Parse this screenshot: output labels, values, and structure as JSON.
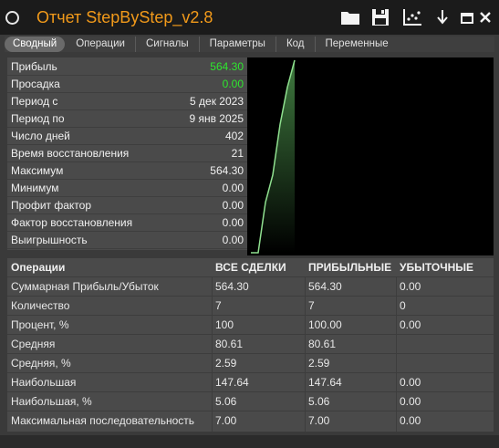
{
  "window": {
    "title": "Отчет StepByStep_v2.8"
  },
  "toolbar": {
    "icons": [
      "folder-icon",
      "save-icon",
      "chart-export-icon",
      "download-icon",
      "minimize-icon",
      "close-icon"
    ]
  },
  "tabs": [
    {
      "label": "Сводный",
      "active": true
    },
    {
      "label": "Операции",
      "active": false
    },
    {
      "label": "Сигналы",
      "active": false
    },
    {
      "label": "Параметры",
      "active": false
    },
    {
      "label": "Код",
      "active": false
    },
    {
      "label": "Переменные",
      "active": false
    }
  ],
  "summary": {
    "rows": [
      {
        "label": "Прибыль",
        "value": "564.30",
        "color": "#2ee62e"
      },
      {
        "label": "Просадка",
        "value": "0.00",
        "color": "#2ee62e"
      },
      {
        "label": "Период с",
        "value": "5 дек 2023"
      },
      {
        "label": "Период по",
        "value": "9 янв 2025"
      },
      {
        "label": "Число дней",
        "value": "402"
      },
      {
        "label": "Время восстановления",
        "value": "21"
      },
      {
        "label": "Максимум",
        "value": "564.30"
      },
      {
        "label": "Минимум",
        "value": "0.00"
      },
      {
        "label": "Профит фактор",
        "value": "0.00"
      },
      {
        "label": "Фактор восстановления",
        "value": "0.00"
      },
      {
        "label": "Выигрышность",
        "value": "0.00"
      }
    ]
  },
  "chart_data": {
    "type": "area",
    "x": [
      0,
      1,
      2,
      3,
      4,
      5,
      6
    ],
    "values": [
      0,
      0,
      147.64,
      228.25,
      375.89,
      485.0,
      564.3
    ],
    "ylim": [
      0,
      564.3
    ],
    "line_color": "#8fe08f",
    "fill_top": "#3f7a3f",
    "fill_bottom": "#000000",
    "title": "",
    "xlabel": "",
    "ylabel": ""
  },
  "table": {
    "headers": [
      "Операции",
      "ВСЕ СДЕЛКИ",
      "ПРИБЫЛЬНЫЕ",
      "УБЫТОЧНЫЕ"
    ],
    "rows": [
      [
        "Суммарная Прибыль/Убыток",
        "564.30",
        "564.30",
        "0.00"
      ],
      [
        "Количество",
        "7",
        "7",
        "0"
      ],
      [
        "Процент, %",
        "100",
        "100.00",
        "0.00"
      ],
      [
        "Средняя",
        "80.61",
        "80.61",
        ""
      ],
      [
        "Средняя, %",
        "2.59",
        "2.59",
        ""
      ],
      [
        "Наибольшая",
        "147.64",
        "147.64",
        "0.00"
      ],
      [
        "Наибольшая, %",
        "5.06",
        "5.06",
        "0.00"
      ],
      [
        "Максимальная последовательность",
        "7.00",
        "7.00",
        "0.00"
      ]
    ]
  }
}
